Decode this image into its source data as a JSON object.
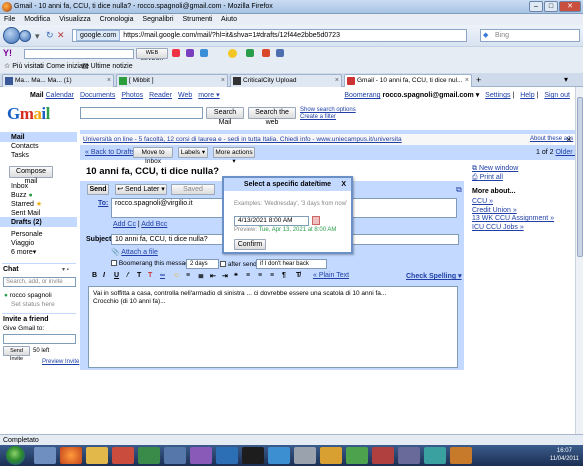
{
  "window": {
    "title": "Gmail - 10 anni fa, CCU, ti dice nulla? - rocco.spagnoli@gmail.com - Mozilla Firefox"
  },
  "menu": [
    "File",
    "Modifica",
    "Visualizza",
    "Cronologia",
    "Segnalibri",
    "Strumenti",
    "Aiuto"
  ],
  "nav": {
    "site": "google.com",
    "url": "https://mail.google.com/mail/?hl=it&shva=1#drafts/12f44e2bbe5d0723",
    "search_placeholder": "Bing"
  },
  "ybar": {
    "web_search": "WEB SEARCH"
  },
  "bookmarks": [
    "Più visitati",
    "Come iniziare",
    "Ultime notizie"
  ],
  "tabs": [
    "Ma... Ma... Ma... (1)",
    "[ Mibbit ]",
    "CriticalCity Upload",
    "Gmail - 10 anni fa, CCU, ti dice nul..."
  ],
  "glinks": {
    "mail": "Mail",
    "items": [
      "Calendar",
      "Documents",
      "Photos",
      "Reader",
      "Web",
      "more ▾"
    ]
  },
  "toplinks": {
    "boomerang": "Boomerang",
    "email": "rocco.spagnoli@gmail.com ▾",
    "settings": "Settings",
    "help": "Help",
    "signout": "Sign out"
  },
  "logo": {
    "text": "Gmail",
    "sub": "by Google"
  },
  "search": {
    "mail_btn": "Search Mail",
    "web_btn": "Search the web",
    "show_options": "Show search options",
    "create_filter": "Create a filter"
  },
  "sidebar": {
    "items": [
      "Mail",
      "Contacts",
      "Tasks"
    ],
    "compose": "Compose mail",
    "folders": [
      "Inbox",
      "Buzz",
      "Starred",
      "Sent Mail",
      "Drafts (2)"
    ],
    "labels": [
      "Personale",
      "Viaggio",
      "6 more▾"
    ],
    "chat_title": "Chat",
    "chat_search_placeholder": "Search, add, or invite",
    "chat_user": "rocco spagnoli",
    "set_status": "Set status here",
    "invite_title": "Invite a friend",
    "give_gmail": "Give Gmail to:",
    "send_invite": "Send Invite",
    "left": "50 left",
    "preview": "Preview Invite"
  },
  "ad": {
    "text": "Università on line - 5 facoltà, 12 corsi di laurea e - sedi in tutta Italia. Chiedi info - www.uniecampus.it/universita",
    "about": "About these ads"
  },
  "toolbar": {
    "back": "« Back to Drafts",
    "move": "Move to Inbox",
    "labels": "Labels ▾",
    "more": "More actions ▾",
    "pager": "1 of 2",
    "older": "Older ›"
  },
  "subject_title": "10 anni fa, CCU, ti dice nulla?",
  "compose": {
    "send": "Send",
    "send_later": "Send Later ▾",
    "saved": "Saved",
    "to_label": "To:",
    "to_value": "rocco.spagnoli@virgilio.it",
    "add_cc": "Add Cc",
    "add_bcc": "Add Bcc",
    "subject_label": "Subject:",
    "subject_value": "10 anni fa, CCU, ti dice nulla?",
    "attach": "Attach a file",
    "boomerang_label": "Boomerang this message",
    "boomerang_days": "2 days",
    "after_sending": "after sending",
    "condition": "if I don't hear back",
    "plain_text": "« Plain Text",
    "check_spelling": "Check Spelling ▾",
    "body_line1": "Vai in soffitta a casa, controlla nell'armadio di sinistra ... ci dovrebbe essere una scatola di 10 anni fa...",
    "body_line2": "Crocchio (di 10 anni fa)..."
  },
  "dialog": {
    "title": "Select a specific date/time",
    "close": "X",
    "examples": "Examples: 'Wednesday', '3 days from now'",
    "input": "4/13/2021 8:00 AM",
    "preview_label": "Preview:",
    "preview_value": "Tue, Apr 13, 2021 at 8:00 AM",
    "confirm": "Confirm"
  },
  "right": {
    "new_window": "New window",
    "print_all": "Print all",
    "more_about": "More about...",
    "links": [
      "CCU »",
      "Credit Union »",
      "13 WK CCU Assignment »",
      "ICU CCU Jobs »"
    ]
  },
  "status": "Completato",
  "clock": {
    "time": "16:07",
    "date": "11/04/2011"
  }
}
